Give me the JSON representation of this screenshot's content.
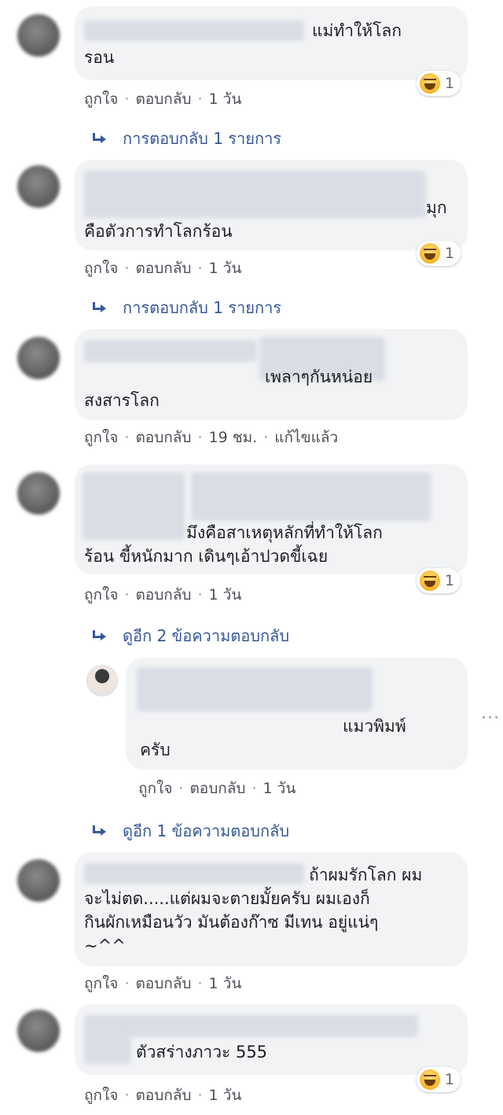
{
  "comments": [
    {
      "text_lines": [
        "แม่ทำให้โลก",
        "รอน"
      ],
      "meta": [
        "ถูกใจ",
        "ตอบกลับ",
        "1 วัน"
      ],
      "reaction_count": "1",
      "replies": "การตอบกลับ 1 รายการ"
    },
    {
      "text_lines": [
        "มุก",
        "คือตัวการทำโลกร้อน"
      ],
      "meta": [
        "ถูกใจ",
        "ตอบกลับ",
        "1 วัน"
      ],
      "reaction_count": "1",
      "replies": "การตอบกลับ 1 รายการ"
    },
    {
      "text_lines": [
        "เพลาๆกันหน่อย",
        "สงสารโลก"
      ],
      "meta": [
        "ถูกใจ",
        "ตอบกลับ",
        "19 ชม.",
        "แก้ไขแล้ว"
      ]
    },
    {
      "text_lines": [
        "มึงคือสาเหตุหลักที่ทำให้โลก",
        "ร้อน ขี้หนักมาก เดินๆเอ้าปวดขี้เฉย"
      ],
      "meta": [
        "ถูกใจ",
        "ตอบกลับ",
        "1 วัน"
      ],
      "reaction_count": "1",
      "replies": "ดูอีก 2 ข้อความตอบกลับ"
    },
    {
      "text_lines": [
        "ถ้าผมรักโลก ผม",
        "จะไม่ตด.....แต่ผมจะตายมั้ยครับ ผมเองก็",
        "กินผักเหมือนวัว มันต้องก๊าซ มีเทน อยู่แน่ๆ",
        "~^^"
      ],
      "meta": [
        "ถูกใจ",
        "ตอบกลับ",
        "1 วัน"
      ]
    },
    {
      "text_lines": [
        "ตัวสร่างภาวะ 555"
      ],
      "meta": [
        "ถูกใจ",
        "ตอบกลับ",
        "1 วัน"
      ],
      "reaction_count": "1"
    }
  ],
  "nested_reply": {
    "text_lines": [
      "แมวพิมพ์",
      "ครับ"
    ],
    "meta": [
      "ถูกใจ",
      "ตอบกลับ",
      "1 วัน"
    ],
    "more": "...",
    "more_replies": "ดูอีก 1 ข้อความตอบกลับ"
  },
  "icons": {
    "reaction": "haha-icon",
    "reply_arrow": "reply-arrow-icon",
    "more": "more-options-icon"
  },
  "colors": {
    "bubble": "#f2f3f5",
    "link": "#365899",
    "meta": "#4b4f56"
  }
}
